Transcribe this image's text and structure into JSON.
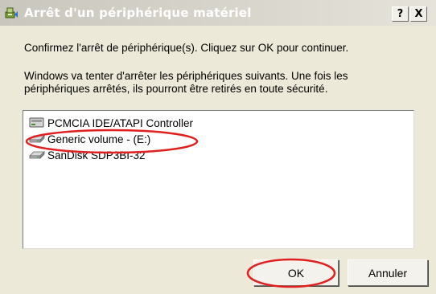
{
  "dialog": {
    "title": "Arrêt d'un périphérique matériel",
    "help_label": "?",
    "close_label": "X",
    "instruction_1": "Confirmez l'arrêt de périphérique(s). Cliquez sur OK pour continuer.",
    "instruction_2_line1": "Windows va tenter d'arrêter les périphériques suivants. Une fois les",
    "instruction_2_line2": "périphériques arrêtés, ils pourront être retirés en toute sécurité.",
    "devices": [
      {
        "label": "PCMCIA IDE/ATAPI Controller",
        "icon": "controller-icon"
      },
      {
        "label": "Generic volume - (E:)",
        "icon": "disk-drive-icon"
      },
      {
        "label": "SanDisk SDP3BI-32",
        "icon": "disk-drive-icon"
      }
    ],
    "ok_label": "OK",
    "cancel_label": "Annuler"
  },
  "annotations": {
    "highlight_color": "#e02020"
  }
}
